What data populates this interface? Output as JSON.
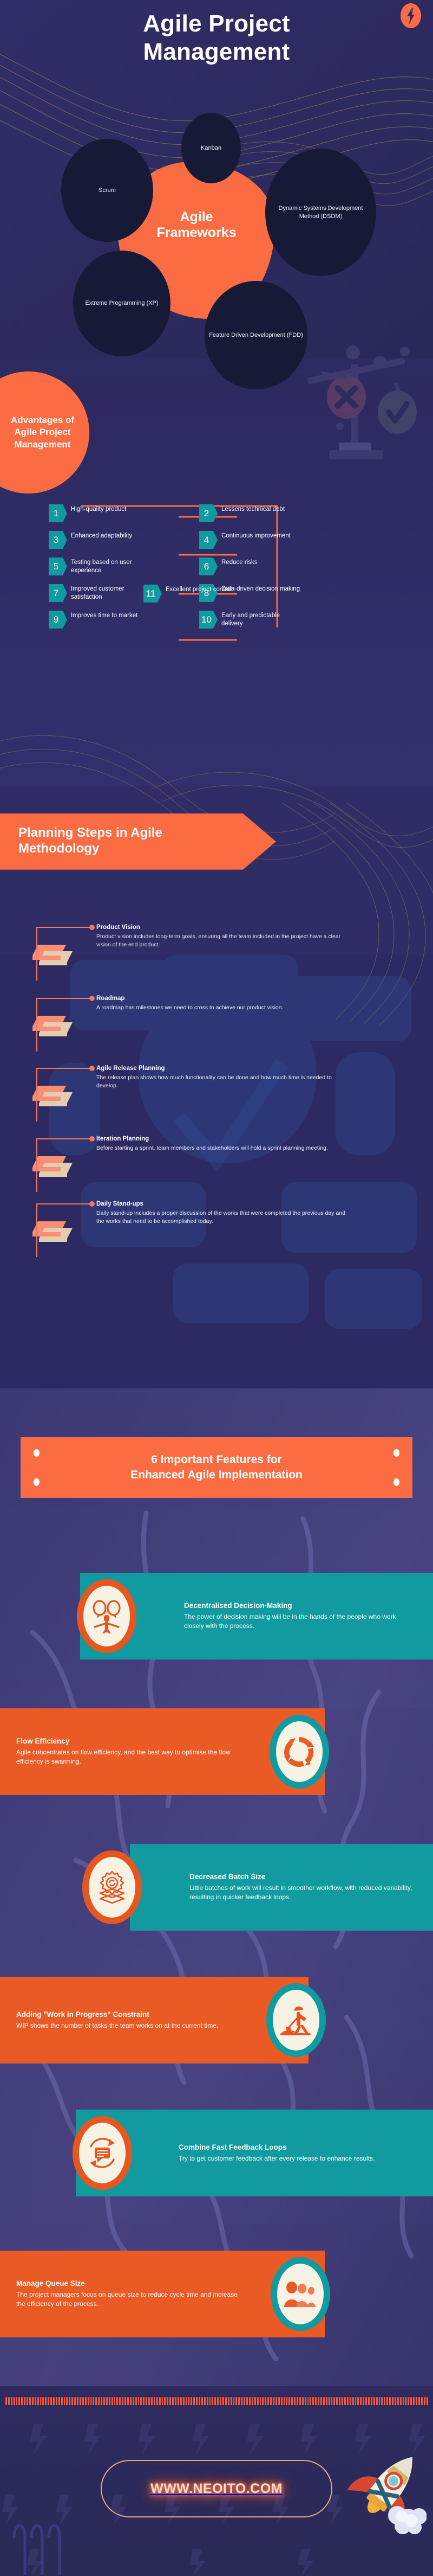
{
  "header": {
    "title_line1": "Agile Project",
    "title_line2": "Management",
    "logo_icon": "lightning-bolt-icon"
  },
  "frameworks": {
    "center_line1": "Agile",
    "center_line2": "Frameworks",
    "items": [
      {
        "label": "Scrum"
      },
      {
        "label": "Kanban"
      },
      {
        "label": "Dynamic Systems Development Method (DSDM)"
      },
      {
        "label": "Extreme Programming (XP)"
      },
      {
        "label": "Feature Driven Development (FDD)"
      }
    ]
  },
  "advantages": {
    "heading_line1": "Advantages of",
    "heading_line2": "Agile Project",
    "heading_line3": "Management",
    "icon": "balance-scale-icon",
    "items": [
      {
        "num": "1",
        "text": "High-quality product"
      },
      {
        "num": "2",
        "text": "Lessens technical debt"
      },
      {
        "num": "3",
        "text": "Enhanced adaptability"
      },
      {
        "num": "4",
        "text": "Continuous improvement"
      },
      {
        "num": "5",
        "text": "Testing based on user experience"
      },
      {
        "num": "6",
        "text": "Reduce risks"
      },
      {
        "num": "7",
        "text": "Improved customer satisfaction"
      },
      {
        "num": "8",
        "text": "Data-driven decision making"
      },
      {
        "num": "9",
        "text": "Improves time to market"
      },
      {
        "num": "10",
        "text": "Early and predictable delivery"
      },
      {
        "num": "11",
        "text": "Excellent project control"
      }
    ]
  },
  "planning": {
    "banner_line1": "Planning Steps in Agile",
    "banner_line2": "Methodology",
    "steps": [
      {
        "title": "Product Vision",
        "desc": "Product vision includes long-term goals, ensuring all the team included in the project have a clear vision of the end product."
      },
      {
        "title": "Roadmap",
        "desc": "A roadmap has milestones we need to cross to achieve our product vision."
      },
      {
        "title": "Agile Release Planning",
        "desc": "The release plan shows how much functionality can be done and how much time is needed to develop."
      },
      {
        "title": "Iteration Planning",
        "desc": "Before starting a sprint, team members and stakeholders will hold a sprint planning meeting."
      },
      {
        "title": "Daily Stand-ups",
        "desc": "Daily stand-up includes a proper discussion of the works that were completed the previous day and the works that need to be accomplished today."
      }
    ]
  },
  "features": {
    "banner_line1": "6 Important Features for",
    "banner_line2": "Enhanced Agile Implementation",
    "items": [
      {
        "title": "Decentralised Decision-Making",
        "desc": "The power of decision making will be in the hands of the people who work closely with the process.",
        "icon": "speech-bubbles-person-icon",
        "bar_color": "#119ba0",
        "ring_color": "#e8561f",
        "side": "left"
      },
      {
        "title": "Flow Efficiency",
        "desc": "Agile concentrates on flow efficiency, and the best way to optimise the flow efficiency is swarming.",
        "icon": "cycle-arrows-icon",
        "bar_color": "#ea5a25",
        "ring_color": "#119ba0",
        "side": "right"
      },
      {
        "title": "Decreased Batch Size",
        "desc": "Little batches of work will result in smoother workflow, with reduced variability, resulting in quicker feedback loops.",
        "icon": "gear-layers-icon",
        "bar_color": "#119ba0",
        "ring_color": "#e8561f",
        "side": "left"
      },
      {
        "title": "Adding \"Work in Progress\" Constraint",
        "desc": "WIP shows the number of tasks the team works on at the current time.",
        "icon": "worker-digging-icon",
        "bar_color": "#ea5a25",
        "ring_color": "#119ba0",
        "side": "right"
      },
      {
        "title": "Combine Fast Feedback Loops",
        "desc": "Try to get customer feedback after every release to enhance results.",
        "icon": "feedback-loop-icon",
        "bar_color": "#119ba0",
        "ring_color": "#e8561f",
        "side": "left"
      },
      {
        "title": "Manage Queue Size",
        "desc": "The project managers focus on queue size to reduce cycle time and increase the efficiency of the process.",
        "icon": "people-group-icon",
        "bar_color": "#ea5a25",
        "ring_color": "#119ba0",
        "side": "right"
      }
    ]
  },
  "footer": {
    "url": "WWW.NEOITO.COM",
    "rocket_icon": "rocket-icon"
  },
  "colors": {
    "background": "#2e2b63",
    "accent_orange": "#fc6c43",
    "accent_teal": "#119ba0",
    "dark_oval": "#161a37",
    "cream": "#f7f3e4"
  }
}
